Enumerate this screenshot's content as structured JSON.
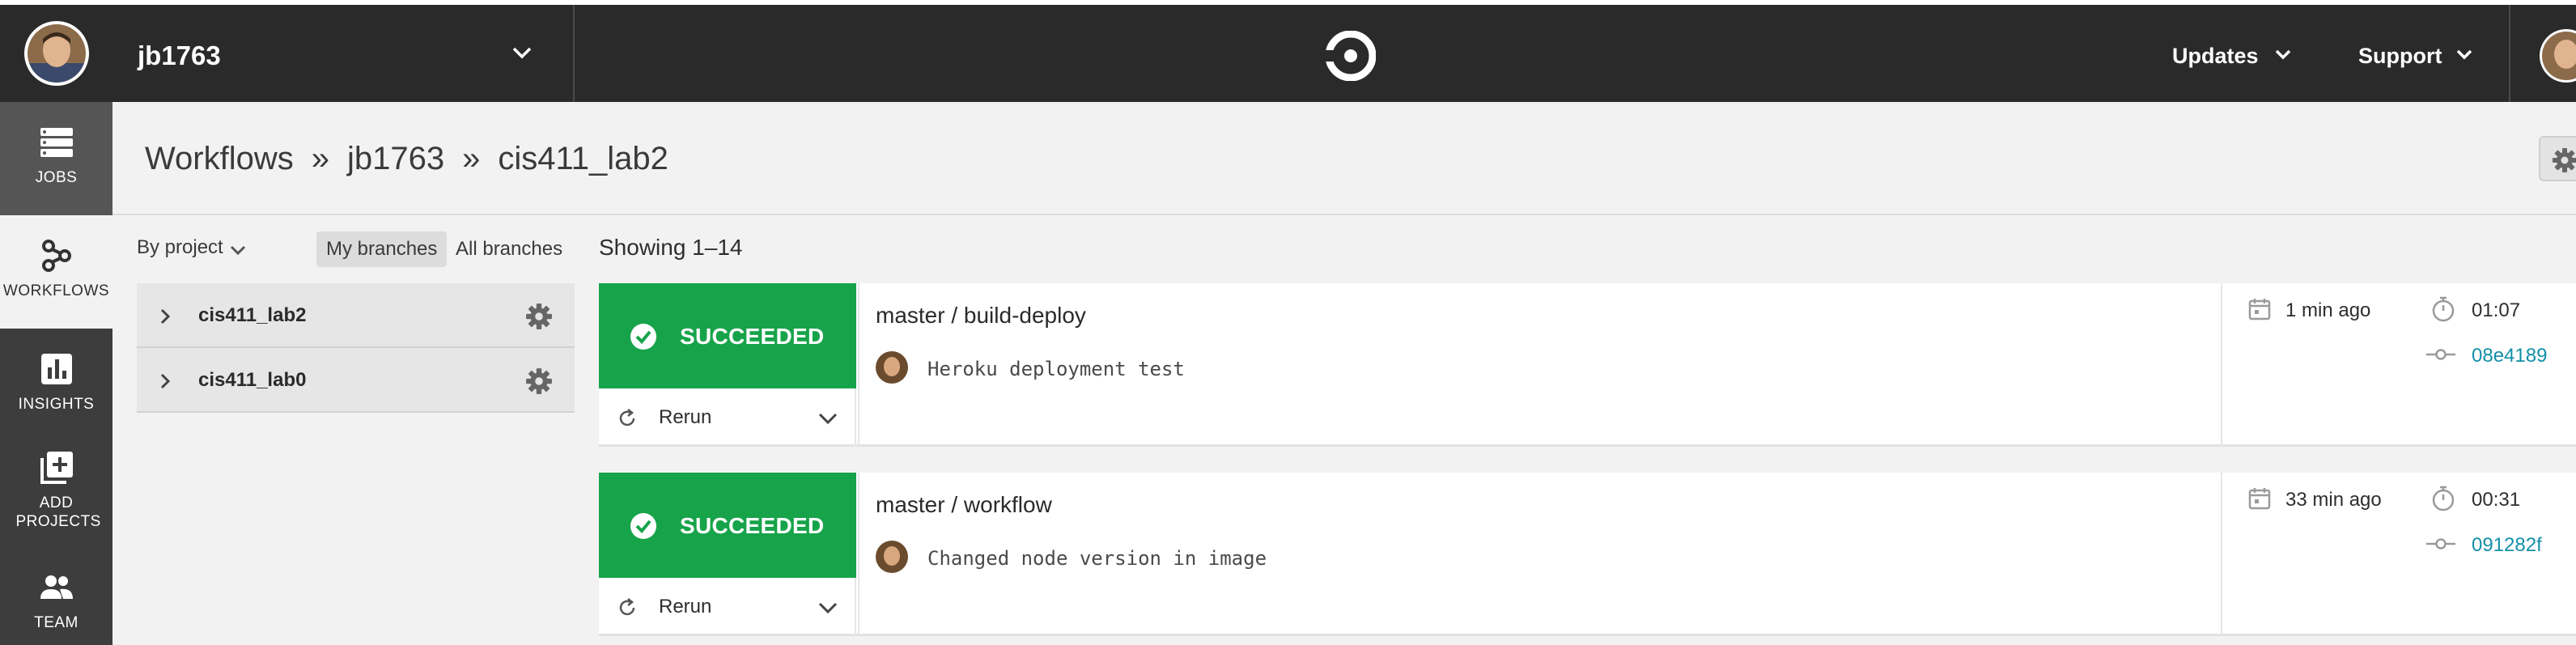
{
  "header_bar": {
    "org_name": "jb1763",
    "nav_updates": "Updates",
    "nav_support": "Support"
  },
  "sidebar": {
    "items": [
      {
        "label": "JOBS",
        "icon": "jobs-icon"
      },
      {
        "label": "WORKFLOWS",
        "icon": "workflows-icon"
      },
      {
        "label": "INSIGHTS",
        "icon": "insights-icon"
      },
      {
        "label": "ADD PROJECTS",
        "icon": "add-projects-icon"
      },
      {
        "label": "TEAM",
        "icon": "team-icon"
      }
    ]
  },
  "breadcrumb": {
    "root": "Workflows",
    "sep": "»",
    "org": "jb1763",
    "project": "cis411_lab2"
  },
  "filters": {
    "by_project": "By project",
    "my_branches": "My branches",
    "all_branches": "All branches"
  },
  "projects": [
    {
      "name": "cis411_lab2"
    },
    {
      "name": "cis411_lab0"
    }
  ],
  "showing": "Showing 1–14",
  "workflows": [
    {
      "status": "SUCCEEDED",
      "rerun": "Rerun",
      "title": "master / build-deploy",
      "commit_message": "Heroku deployment test",
      "time_ago": "1 min ago",
      "duration": "01:07",
      "commit_sha": "08e4189"
    },
    {
      "status": "SUCCEEDED",
      "rerun": "Rerun",
      "title": "master / workflow",
      "commit_message": "Changed node version in image",
      "time_ago": "33 min ago",
      "duration": "00:31",
      "commit_sha": "091282f"
    }
  ],
  "colors": {
    "topbar": "#2a2a2a",
    "sidebar": "#3d3d3d",
    "success": "#17a34a",
    "link": "#138fa8"
  }
}
